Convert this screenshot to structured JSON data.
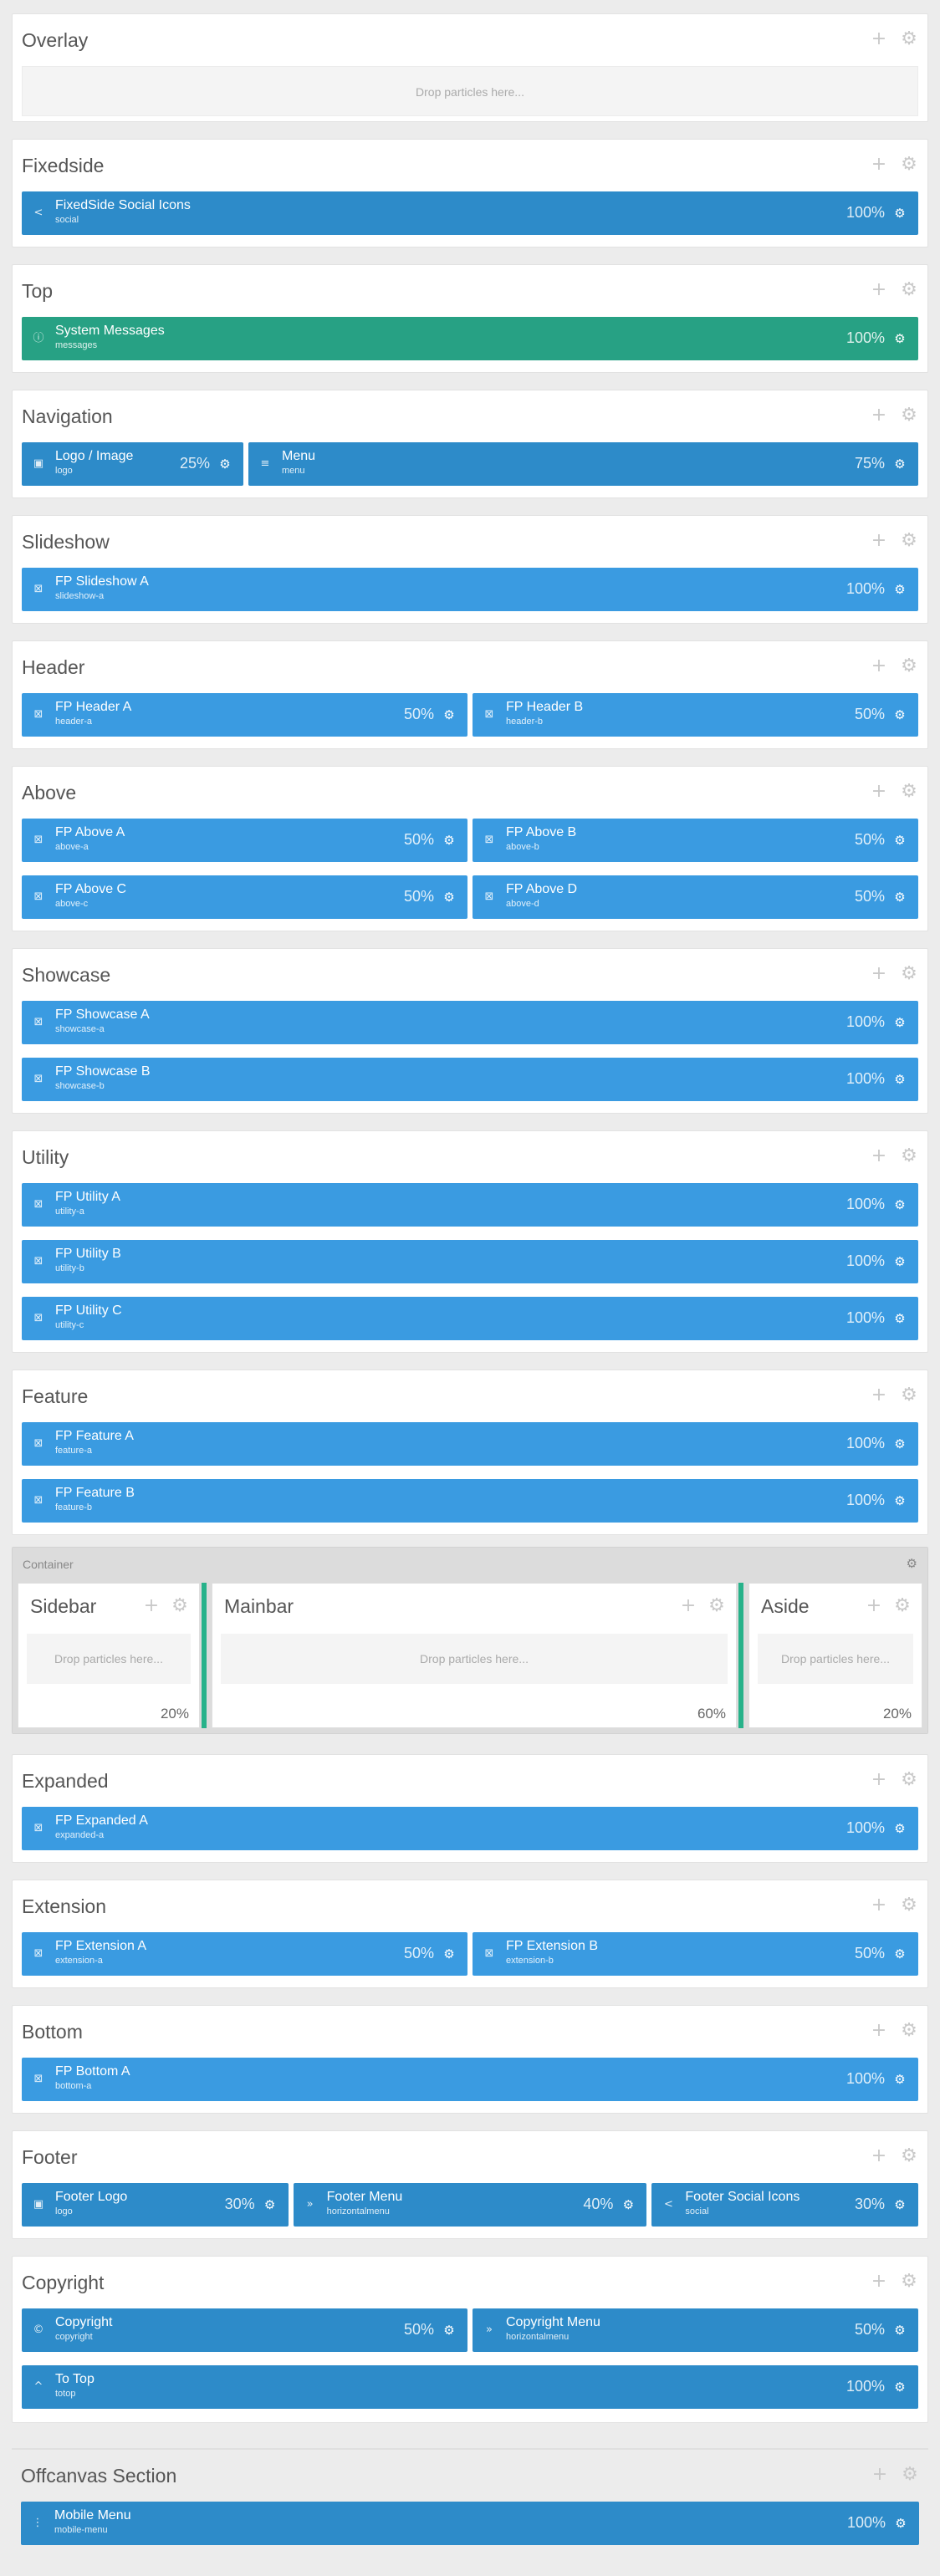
{
  "tools": {
    "add": "+",
    "settings": "⚙"
  },
  "drop_text": "Drop particles here...",
  "sections": {
    "overlay": {
      "title": "Overlay"
    },
    "fixedside": {
      "title": "Fixedside",
      "blocks": [
        {
          "title": "FixedSide Social Icons",
          "sub": "social",
          "size": "100%",
          "icon": "share-icon"
        }
      ]
    },
    "top": {
      "title": "Top",
      "blocks": [
        {
          "title": "System Messages",
          "sub": "messages",
          "size": "100%",
          "icon": "info-icon"
        }
      ]
    },
    "navigation": {
      "title": "Navigation",
      "blocks": [
        {
          "title": "Logo / Image",
          "sub": "logo",
          "size": "25%",
          "icon": "image-icon"
        },
        {
          "title": "Menu",
          "sub": "menu",
          "size": "75%",
          "icon": "menu-icon"
        }
      ]
    },
    "slideshow": {
      "title": "Slideshow",
      "blocks": [
        {
          "title": "FP Slideshow A",
          "sub": "slideshow-a",
          "size": "100%"
        }
      ]
    },
    "header": {
      "title": "Header",
      "blocks": [
        {
          "title": "FP Header A",
          "sub": "header-a",
          "size": "50%"
        },
        {
          "title": "FP Header B",
          "sub": "header-b",
          "size": "50%"
        }
      ]
    },
    "above": {
      "title": "Above",
      "blocks": [
        {
          "title": "FP Above A",
          "sub": "above-a",
          "size": "50%"
        },
        {
          "title": "FP Above B",
          "sub": "above-b",
          "size": "50%"
        },
        {
          "title": "FP Above C",
          "sub": "above-c",
          "size": "50%"
        },
        {
          "title": "FP Above D",
          "sub": "above-d",
          "size": "50%"
        }
      ]
    },
    "showcase": {
      "title": "Showcase",
      "blocks": [
        {
          "title": "FP Showcase A",
          "sub": "showcase-a",
          "size": "100%"
        },
        {
          "title": "FP Showcase B",
          "sub": "showcase-b",
          "size": "100%"
        }
      ]
    },
    "utility": {
      "title": "Utility",
      "blocks": [
        {
          "title": "FP Utility A",
          "sub": "utility-a",
          "size": "100%"
        },
        {
          "title": "FP Utility B",
          "sub": "utility-b",
          "size": "100%"
        },
        {
          "title": "FP Utility C",
          "sub": "utility-c",
          "size": "100%"
        }
      ]
    },
    "feature": {
      "title": "Feature",
      "blocks": [
        {
          "title": "FP Feature A",
          "sub": "feature-a",
          "size": "100%"
        },
        {
          "title": "FP Feature B",
          "sub": "feature-b",
          "size": "100%"
        }
      ]
    },
    "expanded": {
      "title": "Expanded",
      "blocks": [
        {
          "title": "FP Expanded A",
          "sub": "expanded-a",
          "size": "100%"
        }
      ]
    },
    "extension": {
      "title": "Extension",
      "blocks": [
        {
          "title": "FP Extension A",
          "sub": "extension-a",
          "size": "50%"
        },
        {
          "title": "FP Extension B",
          "sub": "extension-b",
          "size": "50%"
        }
      ]
    },
    "bottom": {
      "title": "Bottom",
      "blocks": [
        {
          "title": "FP Bottom A",
          "sub": "bottom-a",
          "size": "100%"
        }
      ]
    },
    "footer": {
      "title": "Footer",
      "blocks": [
        {
          "title": "Footer Logo",
          "sub": "logo",
          "size": "30%",
          "icon": "image-icon"
        },
        {
          "title": "Footer Menu",
          "sub": "horizontalmenu",
          "size": "40%",
          "icon": "forward-icon"
        },
        {
          "title": "Footer Social Icons",
          "sub": "social",
          "size": "30%",
          "icon": "share-icon"
        }
      ]
    },
    "copyright": {
      "title": "Copyright",
      "blocks": [
        {
          "title": "Copyright",
          "sub": "copyright",
          "size": "50%",
          "icon": "copyright-icon"
        },
        {
          "title": "Copyright Menu",
          "sub": "horizontalmenu",
          "size": "50%",
          "icon": "forward-icon"
        },
        {
          "title": "To Top",
          "sub": "totop",
          "size": "100%",
          "icon": "chevron-up-icon"
        }
      ]
    },
    "offcanvas": {
      "title": "Offcanvas Section",
      "blocks": [
        {
          "title": "Mobile Menu",
          "sub": "mobile-menu",
          "size": "100%",
          "icon": "kebab-icon"
        }
      ]
    }
  },
  "container": {
    "label": "Container",
    "columns": [
      {
        "title": "Sidebar",
        "size": "20%"
      },
      {
        "title": "Mainbar",
        "size": "60%"
      },
      {
        "title": "Aside",
        "size": "20%"
      }
    ]
  },
  "colors": {
    "particle": "#2d8bc9",
    "position": "#3a9be1",
    "system": "#27a184",
    "resizer": "#27b28a"
  }
}
